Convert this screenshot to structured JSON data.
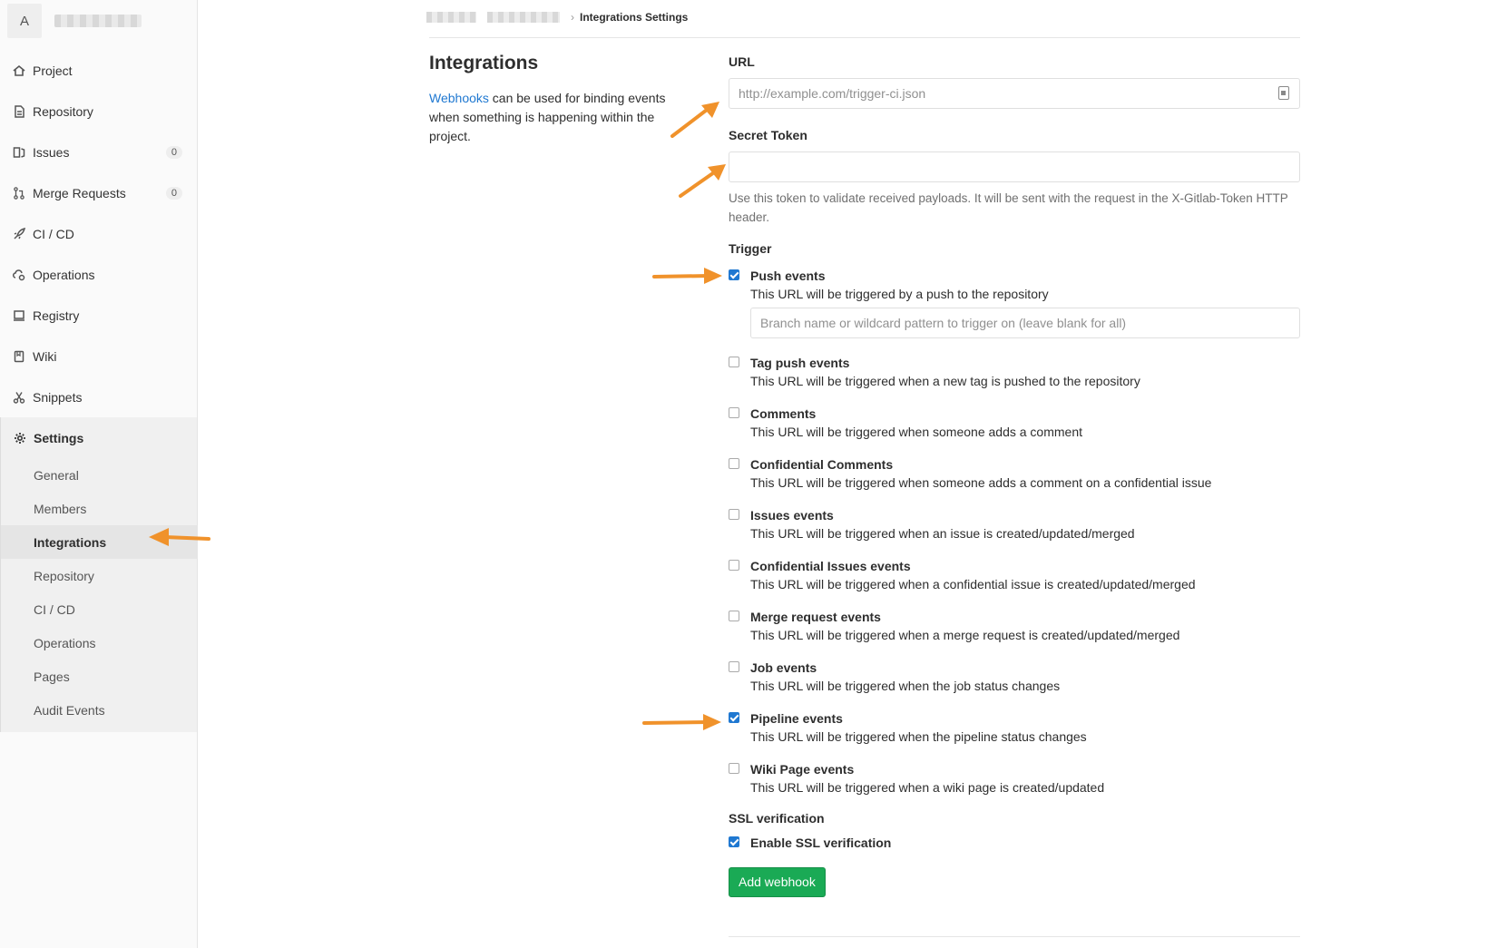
{
  "sidebar": {
    "avatar_letter": "A",
    "items": [
      {
        "label": "Project",
        "icon": "home-icon"
      },
      {
        "label": "Repository",
        "icon": "doc-icon"
      },
      {
        "label": "Issues",
        "icon": "issues-icon",
        "count": "0"
      },
      {
        "label": "Merge Requests",
        "icon": "merge-request-icon",
        "count": "0"
      },
      {
        "label": "CI / CD",
        "icon": "rocket-icon"
      },
      {
        "label": "Operations",
        "icon": "cloud-gear-icon"
      },
      {
        "label": "Registry",
        "icon": "registry-icon"
      },
      {
        "label": "Wiki",
        "icon": "book-icon"
      },
      {
        "label": "Snippets",
        "icon": "scissors-icon"
      }
    ],
    "settings": {
      "label": "Settings",
      "icon": "gear-icon",
      "subitems": [
        "General",
        "Members",
        "Integrations",
        "Repository",
        "CI / CD",
        "Operations",
        "Pages",
        "Audit Events"
      ],
      "active": "Integrations"
    }
  },
  "breadcrumb": {
    "current": "Integrations Settings"
  },
  "intro": {
    "title": "Integrations",
    "link_text": "Webhooks",
    "text": " can be used for binding events when something is happening within the project."
  },
  "form": {
    "url_label": "URL",
    "url_placeholder": "http://example.com/trigger-ci.json",
    "token_label": "Secret Token",
    "token_help": "Use this token to validate received payloads. It will be sent with the request in the X-Gitlab-Token HTTP header.",
    "trigger_label": "Trigger",
    "branch_placeholder": "Branch name or wildcard pattern to trigger on (leave blank for all)",
    "triggers": [
      {
        "title": "Push events",
        "desc": "This URL will be triggered by a push to the repository",
        "checked": true
      },
      {
        "title": "Tag push events",
        "desc": "This URL will be triggered when a new tag is pushed to the repository",
        "checked": false
      },
      {
        "title": "Comments",
        "desc": "This URL will be triggered when someone adds a comment",
        "checked": false
      },
      {
        "title": "Confidential Comments",
        "desc": "This URL will be triggered when someone adds a comment on a confidential issue",
        "checked": false
      },
      {
        "title": "Issues events",
        "desc": "This URL will be triggered when an issue is created/updated/merged",
        "checked": false
      },
      {
        "title": "Confidential Issues events",
        "desc": "This URL will be triggered when a confidential issue is created/updated/merged",
        "checked": false
      },
      {
        "title": "Merge request events",
        "desc": "This URL will be triggered when a merge request is created/updated/merged",
        "checked": false
      },
      {
        "title": "Job events",
        "desc": "This URL will be triggered when the job status changes",
        "checked": false
      },
      {
        "title": "Pipeline events",
        "desc": "This URL will be triggered when the pipeline status changes",
        "checked": true
      },
      {
        "title": "Wiki Page events",
        "desc": "This URL will be triggered when a wiki page is created/updated",
        "checked": false
      }
    ],
    "ssl_label": "SSL verification",
    "ssl_option": "Enable SSL verification",
    "ssl_checked": true,
    "submit_label": "Add webhook"
  },
  "colors": {
    "accent_blue": "#1f78d1",
    "button_green": "#1aaa55",
    "annotation_arrow": "#f0922b"
  }
}
